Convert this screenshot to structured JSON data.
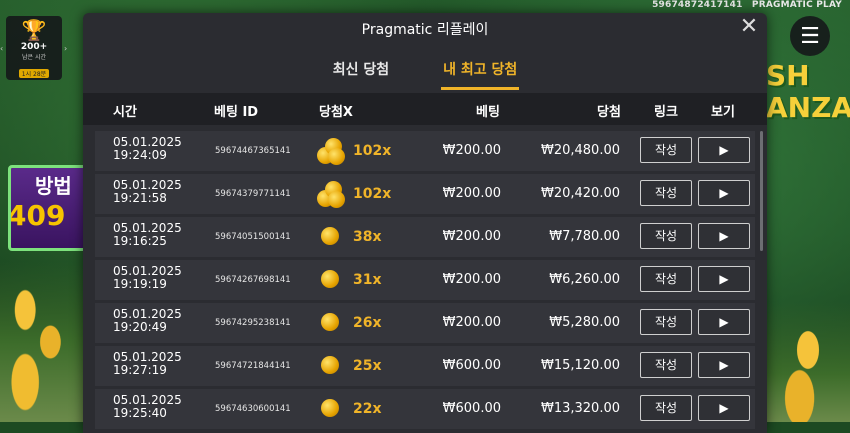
{
  "game": {
    "session_id": "59674872417141",
    "brand": "PRAGMATIC PLAY",
    "trophy_count": "200+",
    "trophy_sub": "남은 시간",
    "trophy_badge": "1시 28분",
    "promo_top": "방법",
    "promo_number": "409",
    "logo_line1": "SH",
    "logo_line2": "ANZA",
    "menu_icon": "hamburger-icon",
    "nav_left": "‹",
    "nav_right": "›"
  },
  "modal": {
    "title": "Pragmatic 리플레이",
    "close_label": "✕",
    "tabs": [
      {
        "label": "최신 당첨",
        "active": false
      },
      {
        "label": "내 최고 당첨",
        "active": true
      }
    ],
    "columns": {
      "time": "시간",
      "bet_id": "베팅 ID",
      "multiplier": "당첨X",
      "bet": "베팅",
      "win": "당첨",
      "link": "링크",
      "view": "보기"
    },
    "rows": [
      {
        "date": "05.01.2025",
        "time": "19:24:09",
        "bet_id": "59674467365141",
        "mult": "102x",
        "bet": "₩200.00",
        "win": "₩20,480.00",
        "link_label": "작성",
        "view_icon": "play-icon",
        "coin": "stack"
      },
      {
        "date": "05.01.2025",
        "time": "19:21:58",
        "bet_id": "59674379771141",
        "mult": "102x",
        "bet": "₩200.00",
        "win": "₩20,420.00",
        "link_label": "작성",
        "view_icon": "play-icon",
        "coin": "stack"
      },
      {
        "date": "05.01.2025",
        "time": "19:16:25",
        "bet_id": "59674051500141",
        "mult": "38x",
        "bet": "₩200.00",
        "win": "₩7,780.00",
        "link_label": "작성",
        "view_icon": "play-icon",
        "coin": "single"
      },
      {
        "date": "05.01.2025",
        "time": "19:19:19",
        "bet_id": "59674267698141",
        "mult": "31x",
        "bet": "₩200.00",
        "win": "₩6,260.00",
        "link_label": "작성",
        "view_icon": "play-icon",
        "coin": "single"
      },
      {
        "date": "05.01.2025",
        "time": "19:20:49",
        "bet_id": "59674295238141",
        "mult": "26x",
        "bet": "₩200.00",
        "win": "₩5,280.00",
        "link_label": "작성",
        "view_icon": "play-icon",
        "coin": "single"
      },
      {
        "date": "05.01.2025",
        "time": "19:27:19",
        "bet_id": "59674721844141",
        "mult": "25x",
        "bet": "₩600.00",
        "win": "₩15,120.00",
        "link_label": "작성",
        "view_icon": "play-icon",
        "coin": "single"
      },
      {
        "date": "05.01.2025",
        "time": "19:25:40",
        "bet_id": "59674630600141",
        "mult": "22x",
        "bet": "₩600.00",
        "win": "₩13,320.00",
        "link_label": "작성",
        "view_icon": "play-icon",
        "coin": "single"
      }
    ]
  },
  "colors": {
    "accent": "#f0b429",
    "modal_bg": "#2b2c31",
    "row_bg": "#34353b",
    "header_bg": "#1f2024"
  }
}
